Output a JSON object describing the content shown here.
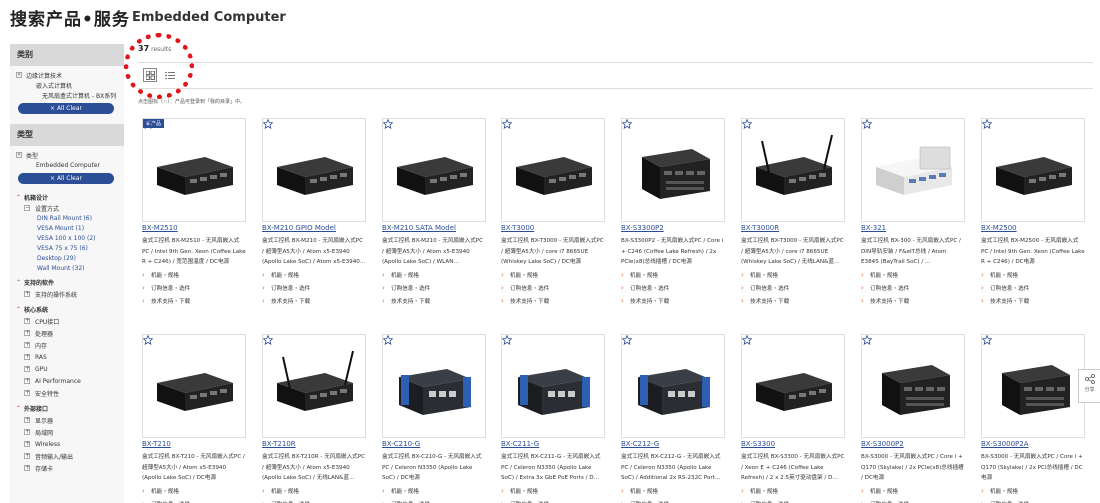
{
  "header": {
    "site_title": "搜索产品•服务",
    "page_title": "Embedded Computer"
  },
  "sidebar": {
    "category_header": "类别",
    "category_filter": {
      "selected": "边缘计算技术",
      "sub1": "嵌入式计算机",
      "sub2": "无风扇盒式计算机 - BX系列",
      "clear_label": "All Clear"
    },
    "type_header": "类型",
    "type_filter": {
      "selected": "类型",
      "sub1": "Embedded Computer",
      "clear_label": "All Clear"
    },
    "tree": [
      {
        "label": "机箱设计",
        "expanded": true
      },
      {
        "label": "设置方式",
        "expanded": true
      },
      {
        "label": "DIN Rail Mount (6)"
      },
      {
        "label": "VESA Mount (1)"
      },
      {
        "label": "VESA 100 x 100 (2)"
      },
      {
        "label": "VESA 75 x 75 (6)"
      },
      {
        "label": "Desktop (29)"
      },
      {
        "label": "Wall Mount (32)"
      },
      {
        "label": "支持的软件",
        "expanded": true
      },
      {
        "label": "支持的操作系统"
      },
      {
        "label": "核心系统",
        "expanded": true
      },
      {
        "label": "CPU接口"
      },
      {
        "label": "处理器"
      },
      {
        "label": "内存"
      },
      {
        "label": "RAS"
      },
      {
        "label": "GPU"
      },
      {
        "label": "AI Performance"
      },
      {
        "label": "安全特性"
      },
      {
        "label": "外部接口",
        "expanded": true
      },
      {
        "label": "显示器"
      },
      {
        "label": "局域网"
      },
      {
        "label": "Wireless"
      },
      {
        "label": "音频输入/输出"
      },
      {
        "label": "存储卡"
      }
    ]
  },
  "results": {
    "count": "37",
    "word": "results",
    "note": "点击图标（☆）：产品可登录到「我的目录」中。"
  },
  "new_badge": "新产品",
  "card_links": {
    "spec": "机能・规格",
    "order": "订购信息・选件",
    "support": "技术支持・下载"
  },
  "products": [
    {
      "name": "BX-M2510",
      "desc": "盒式工控机 BX-M2510 - 无风扇嵌入式PC / Intel 9th Gen. Xeon (Coffee Lake R + C246) / 宽范围温度 / DC电源",
      "is_new": true,
      "antenna": false,
      "style": "black"
    },
    {
      "name": "BX-M210 GPIO Model",
      "desc": "盒式工控机 BX-M210 - 无风扇嵌入式PC / 超薄型A5大小 / Atom x5-E3940 (Apollo Lake SoC) / Atom x5-E3940…",
      "is_new": false,
      "antenna": false,
      "style": "black"
    },
    {
      "name": "BX-M210 SATA Model",
      "desc": "盒式工控机 BX-M210 - 无风扇嵌入式PC / 超薄型A5大小 / Atom x5-E3940 (Apollo Lake SoC) / WLAN…",
      "is_new": false,
      "antenna": false,
      "style": "black"
    },
    {
      "name": "BX-T3000",
      "desc": "盒式工控机 BX-T3000 - 无风扇嵌入式PC / 超薄型A5大小 / core i7 8665UE (Whiskey Lake SoC) / DC电源",
      "is_new": false,
      "antenna": false,
      "style": "black"
    },
    {
      "name": "BX-S3300P2",
      "desc": "BX-S3300P2 - 无风扇嵌入式PC / Core i + C246 (Coffee Lake Refresh) / 2x PCIe(x8)总线插槽 / DC电源",
      "is_new": false,
      "antenna": false,
      "style": "tall"
    },
    {
      "name": "BX-T3000R",
      "desc": "盒式工控机 BX-T3000 - 无风扇嵌入式PC / 超薄型A5大小 / core i7 8665UE (Whiskey Lake SoC) / 无线LAN&蓝…",
      "is_new": false,
      "antenna": true,
      "style": "black"
    },
    {
      "name": "BX-321",
      "desc": "盒式工控机 BX-300 - 无风扇嵌入式PC / DIN导轨安装 / F&eIT总线 / Atom E3845 (BayTrail SoC) / …",
      "is_new": false,
      "antenna": false,
      "style": "white"
    },
    {
      "name": "BX-M2500",
      "desc": "盒式工控机 BX-M2500 - 无风扇嵌入式PC / Intel 9th Gen. Xeon (Coffee Lake R + C246) / DC电源",
      "is_new": false,
      "antenna": false,
      "style": "black"
    },
    {
      "name": "BX-T210",
      "desc": "盒式工控机 BX-T210 - 无风扇嵌入式PC / 超薄型A5大小 / Atom x5-E3940 (Apollo Lake SoC) / DC电源",
      "is_new": false,
      "antenna": false,
      "style": "black"
    },
    {
      "name": "BX-T210R",
      "desc": "盒式工控机 BX-T210R - 无风扇嵌入式PC / 超薄型A5大小 / Atom x5-E3940 (Apollo Lake SoC) / 无线LAN&蓝…",
      "is_new": false,
      "antenna": true,
      "style": "black"
    },
    {
      "name": "BX-C210-G",
      "desc": "盒式工控机 BX-C210-G - 无风扇嵌入式PC / Celeron N3350 (Apollo Lake SoC) / DC电源",
      "is_new": false,
      "antenna": false,
      "style": "blue"
    },
    {
      "name": "BX-C211-G",
      "desc": "盒式工控机 BX-C211-G - 无风扇嵌入式PC / Celeron N3350 (Apollo Lake SoC) / Extra 3x GbE PoE Ports / D…",
      "is_new": false,
      "antenna": false,
      "style": "blue"
    },
    {
      "name": "BX-C212-G",
      "desc": "盒式工控机 BX-C212-G - 无风扇嵌入式PC / Celeron N3350 (Apollo Lake SoC) / Additional 2x RS-232C Port…",
      "is_new": false,
      "antenna": false,
      "style": "blue"
    },
    {
      "name": "BX-S3300",
      "desc": "盒式工控机 BX-S3300 - 无风扇嵌入式PC / Xeon E + C246 (Coffee Lake Refresh) / 2 x 2.5英寸驱动盘架 / D…",
      "is_new": false,
      "antenna": false,
      "style": "black"
    },
    {
      "name": "BX-S3000P2",
      "desc": "BX-S3000 - 无风扇嵌入式PC / Core i + Q170 (Skylake) / 2x PCIe(x8)总线插槽 / DC电源",
      "is_new": false,
      "antenna": false,
      "style": "tall"
    },
    {
      "name": "BX-S3000P2A",
      "desc": "BX-S3000 - 无风扇嵌入式PC / Core i + Q170 (Skylake) / 2x PCI总线插槽 / DC电源",
      "is_new": false,
      "antenna": false,
      "style": "tall"
    }
  ],
  "share_tab": "分享"
}
